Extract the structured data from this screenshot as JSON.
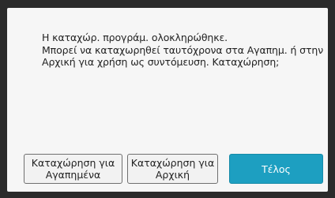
{
  "dialog": {
    "message_lines": [
      "Η καταχώρ. προγράμ. ολοκληρώθηκε.",
      "Μπορεί να καταχωρηθεί ταυτόχρονα στα Αγαπημ. ή στην",
      "Αρχική για χρήση ως συντόμευση. Καταχώρηση;"
    ],
    "buttons": {
      "register_favorites": "Καταχώρηση για\nΑγαπημένα",
      "register_home": "Καταχώρηση για\nΑρχική",
      "finish": "Τέλος"
    }
  },
  "colors": {
    "frame": "#2b2b2b",
    "dialog_background": "#f6f6f6",
    "accent_button": "#1d9fc1"
  }
}
